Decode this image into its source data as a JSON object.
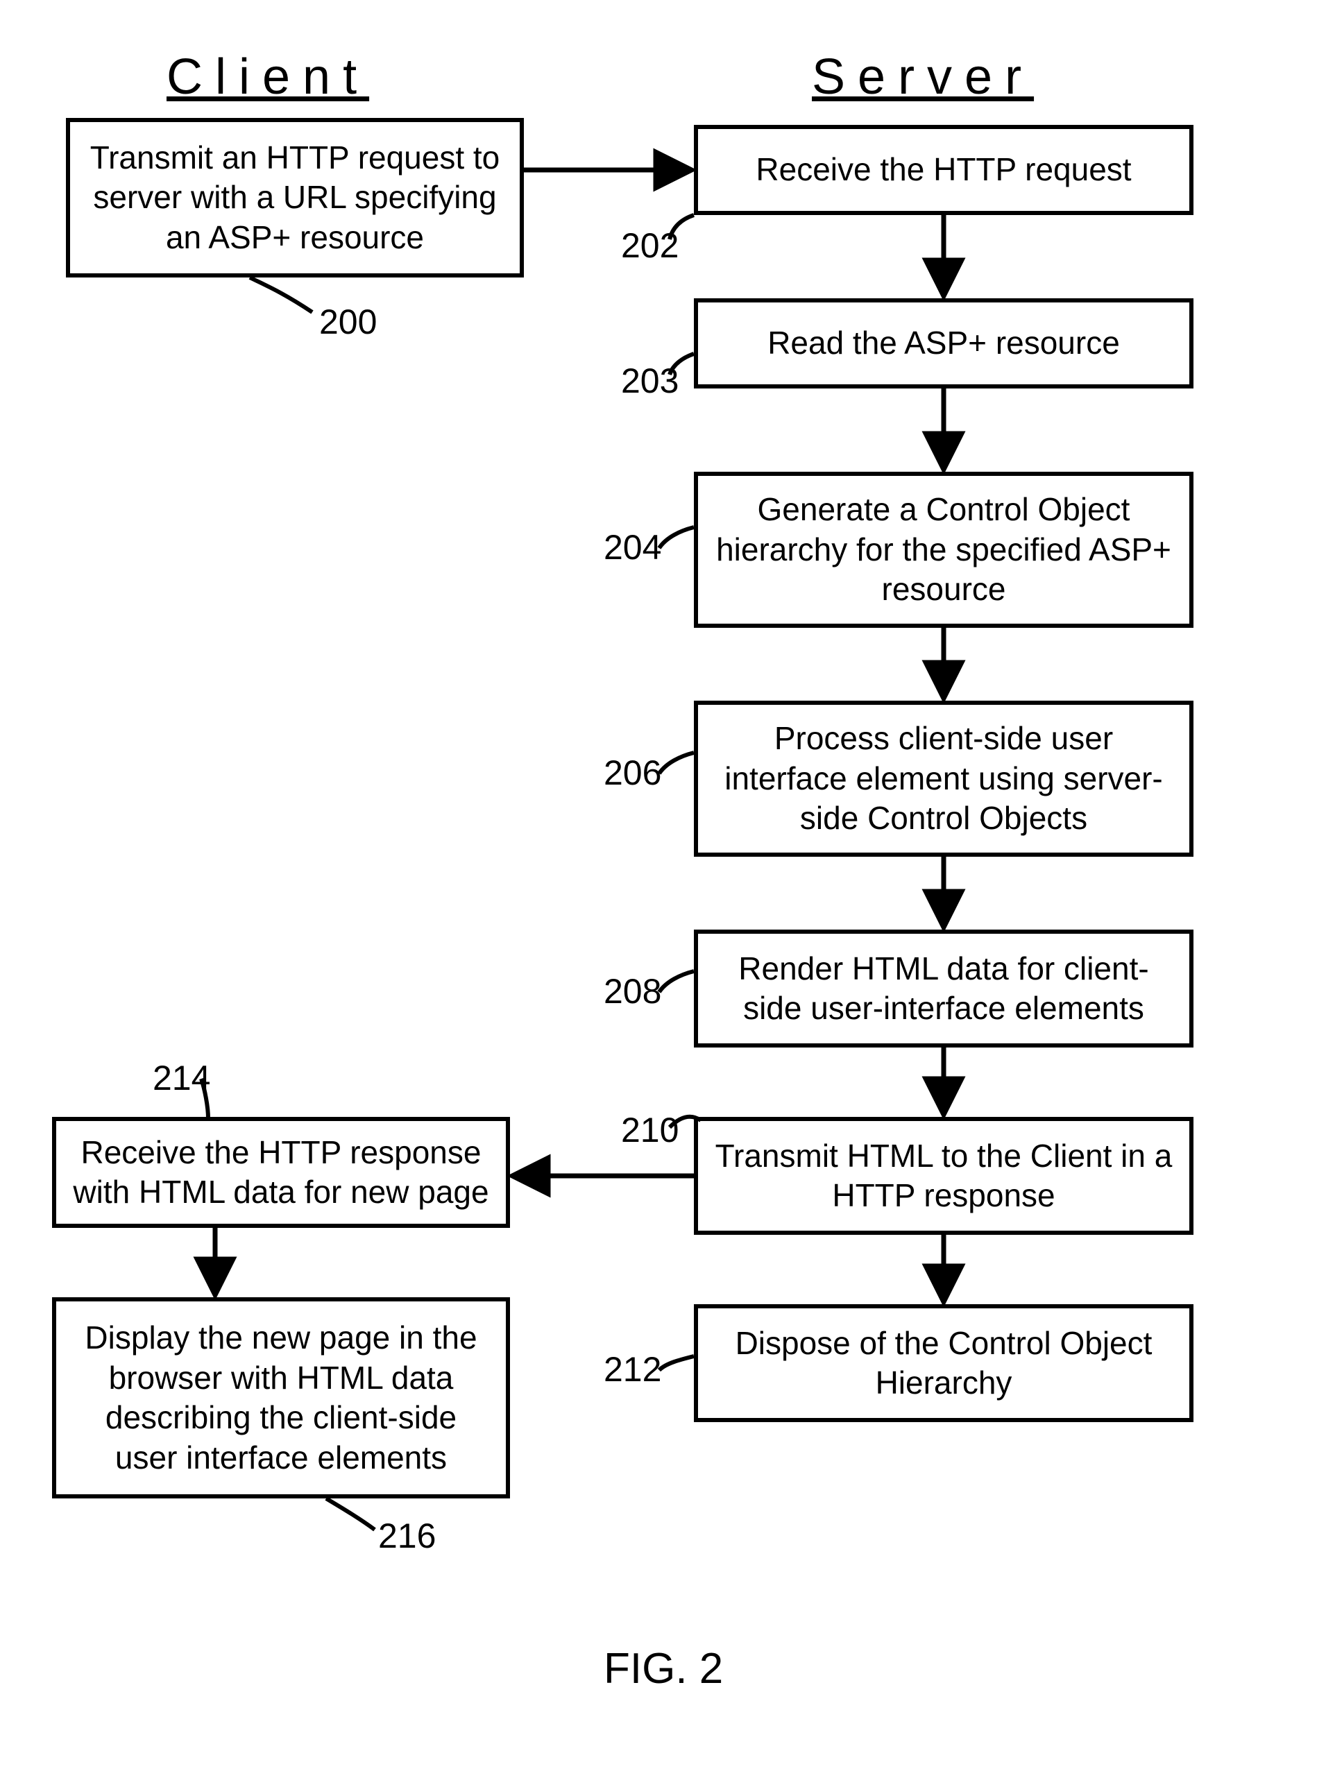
{
  "headers": {
    "client": "Client",
    "server": "Server"
  },
  "steps": {
    "s200": "Transmit an HTTP request to server with a URL specifying an ASP+ resource",
    "s202": "Receive the HTTP request",
    "s203": "Read the ASP+ resource",
    "s204": "Generate a Control Object hierarchy for the specified ASP+ resource",
    "s206": "Process client-side user interface element using server-side Control Objects",
    "s208": "Render HTML data for client-side user-interface elements",
    "s210": "Transmit HTML to the Client in a HTTP response",
    "s212": "Dispose of the Control Object Hierarchy",
    "s214": "Receive the HTTP response with HTML data for new page",
    "s216": "Display the new page in the browser with HTML data describing the client-side user interface elements"
  },
  "refs": {
    "r200": "200",
    "r202": "202",
    "r203": "203",
    "r204": "204",
    "r206": "206",
    "r208": "208",
    "r210": "210",
    "r212": "212",
    "r214": "214",
    "r216": "216"
  },
  "figure": "FIG. 2"
}
